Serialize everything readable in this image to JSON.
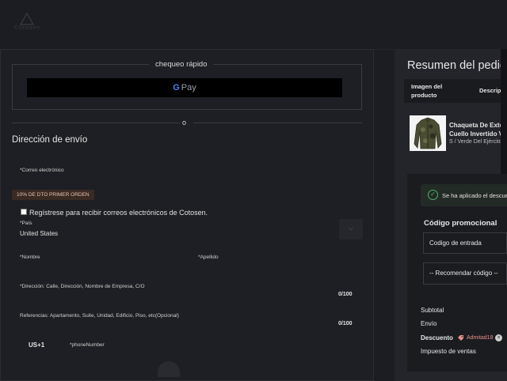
{
  "header": {
    "logo_text": "Cotosen"
  },
  "quick_checkout": {
    "label": "chequeo rápido",
    "gpay_g": "G",
    "gpay_pay": "Pay",
    "or_text": "o"
  },
  "shipping": {
    "title": "Dirección de envío",
    "email_label": "*Correo electrónico",
    "discount_badge": "10% DE DTO PRIMER ORDEN",
    "subscribe_label": "Regístrese para recibir correos electrónicos de Cotosen.",
    "subscribe_checked": false,
    "country_label": "*País",
    "country_value": "United States",
    "first_name_label": "*Nombre",
    "last_name_label": "*Apellido",
    "address_label": "*Dirección: Calle, Dirección, Nombre de Empresa, C/O",
    "address_counter": "0/100",
    "references_label": "Referencias: Apartamento, Suite, Unidad, Edificio, Piso, etc(Opcional)",
    "references_counter": "0/100",
    "country_code": "US+1",
    "phone_label": "*phoneNumber"
  },
  "summary": {
    "title": "Resumen del pedido",
    "col_image": "Imagen del producto",
    "col_description": "Descripción",
    "product_name_line1": "Chaqueta De Exterior",
    "product_name_line2": "Cuello Invertido Ve",
    "product_variant": "S / Verde Del Ejército",
    "applied_text": "Se ha aplicado el descuento",
    "promo_title": "Código promocional",
    "code_placeholder": "Codigo de entrada",
    "recommend_label": "-- Recomendar código --",
    "subtotal_label": "Subtotal",
    "shipping_label": "Envío",
    "discount_label": "Descuento",
    "discount_code": "Admitad18",
    "tax_label": "Impuesto de ventas"
  },
  "colors": {
    "background": "#1c1d22",
    "accent_discount": "#e8908b",
    "success": "#4caf6d"
  },
  "icons": {
    "gpay": "google-pay-icon",
    "check": "check-circle-icon",
    "tag": "tag-icon",
    "remove": "close-circle-icon",
    "dropdown": "chevron-icon"
  }
}
